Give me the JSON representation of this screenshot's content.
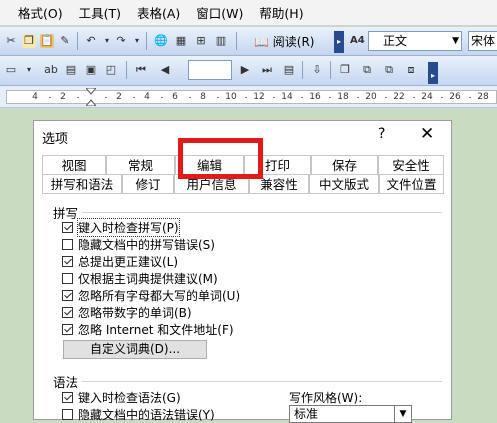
{
  "menu": [
    "格式(O)",
    "工具(T)",
    "表格(A)",
    "窗口(W)",
    "帮助(H)"
  ],
  "toolbar": {
    "reading_button": "阅读(R)",
    "style_value": "正文",
    "font_value": "宋体",
    "style_icon": "A4-style-icon"
  },
  "ruler": {
    "numbers": [
      "4",
      "2",
      "",
      "2",
      "4",
      "6",
      "8",
      "10",
      "12",
      "14",
      "16",
      "18",
      "20",
      "22",
      "24",
      "26",
      "28"
    ]
  },
  "dialog": {
    "title": "选项",
    "help": "?",
    "close": "✕",
    "tabs_row1": [
      "视图",
      "常规",
      "编辑",
      "打印",
      "保存",
      "安全性"
    ],
    "tabs_row2": [
      "拼写和语法",
      "修订",
      "用户信息",
      "兼容性",
      "中文版式",
      "文件位置"
    ],
    "active_tab": "拼写和语法",
    "spelling": {
      "heading": "拼写",
      "options": [
        {
          "label": "键入时检查拼写(P)",
          "checked": true
        },
        {
          "label": "隐藏文档中的拼写错误(S)",
          "checked": false
        },
        {
          "label": "总提出更正建议(L)",
          "checked": true
        },
        {
          "label": "仅根据主词典提供建议(M)",
          "checked": false
        },
        {
          "label": "忽略所有字母都大写的单词(U)",
          "checked": true
        },
        {
          "label": "忽略带数字的单词(B)",
          "checked": true
        },
        {
          "label": "忽略 Internet 和文件地址(F)",
          "checked": true
        }
      ],
      "custom_dict_button": "自定义词典(D)..."
    },
    "grammar": {
      "heading": "语法",
      "options": [
        {
          "label": "键入时检查语法(G)",
          "checked": true
        },
        {
          "label": "隐藏文档中的语法错误(Y)",
          "checked": false
        }
      ],
      "writing_style_label": "写作风格(W):",
      "writing_style_value": "标准"
    }
  }
}
